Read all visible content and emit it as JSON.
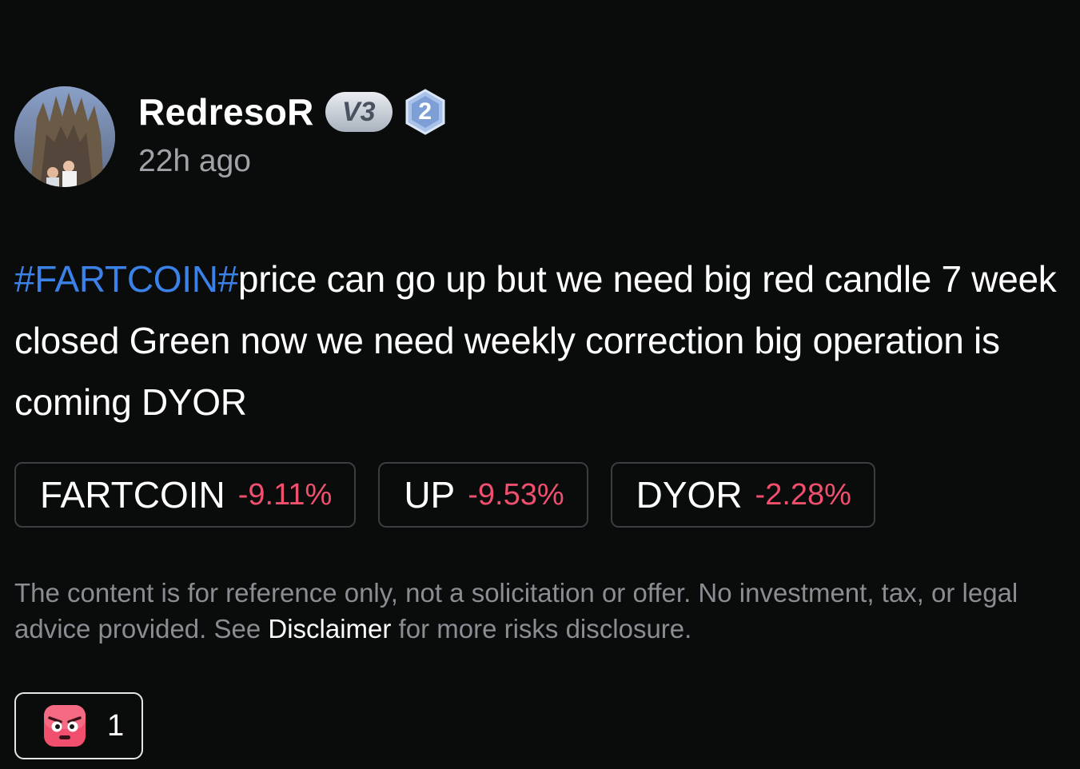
{
  "author": {
    "name": "RedresoR",
    "vip_label": "V3",
    "level": "2",
    "time": "22h ago",
    "avatar_icon": "profile-photo"
  },
  "post": {
    "hashtag": "#FARTCOIN#",
    "text": "price can go up but we need big red candle 7 week closed Green now we need weekly correction big operation is coming DYOR"
  },
  "tickers": [
    {
      "symbol": "FARTCOIN",
      "change": "-9.11%"
    },
    {
      "symbol": "UP",
      "change": "-9.53%"
    },
    {
      "symbol": "DYOR",
      "change": "-2.28%"
    }
  ],
  "disclaimer": {
    "text_before": "The content is for reference only, not a solicitation or offer. No investment, tax, or legal advice provided. See ",
    "link": "Disclaimer",
    "text_after": " for more risks disclosure."
  },
  "reaction": {
    "icon": "angry-face-icon",
    "count": "1"
  },
  "colors": {
    "background": "#0a0b0b",
    "hashtag": "#3b82e8",
    "negative": "#f0506e",
    "muted": "#8a8d92"
  }
}
